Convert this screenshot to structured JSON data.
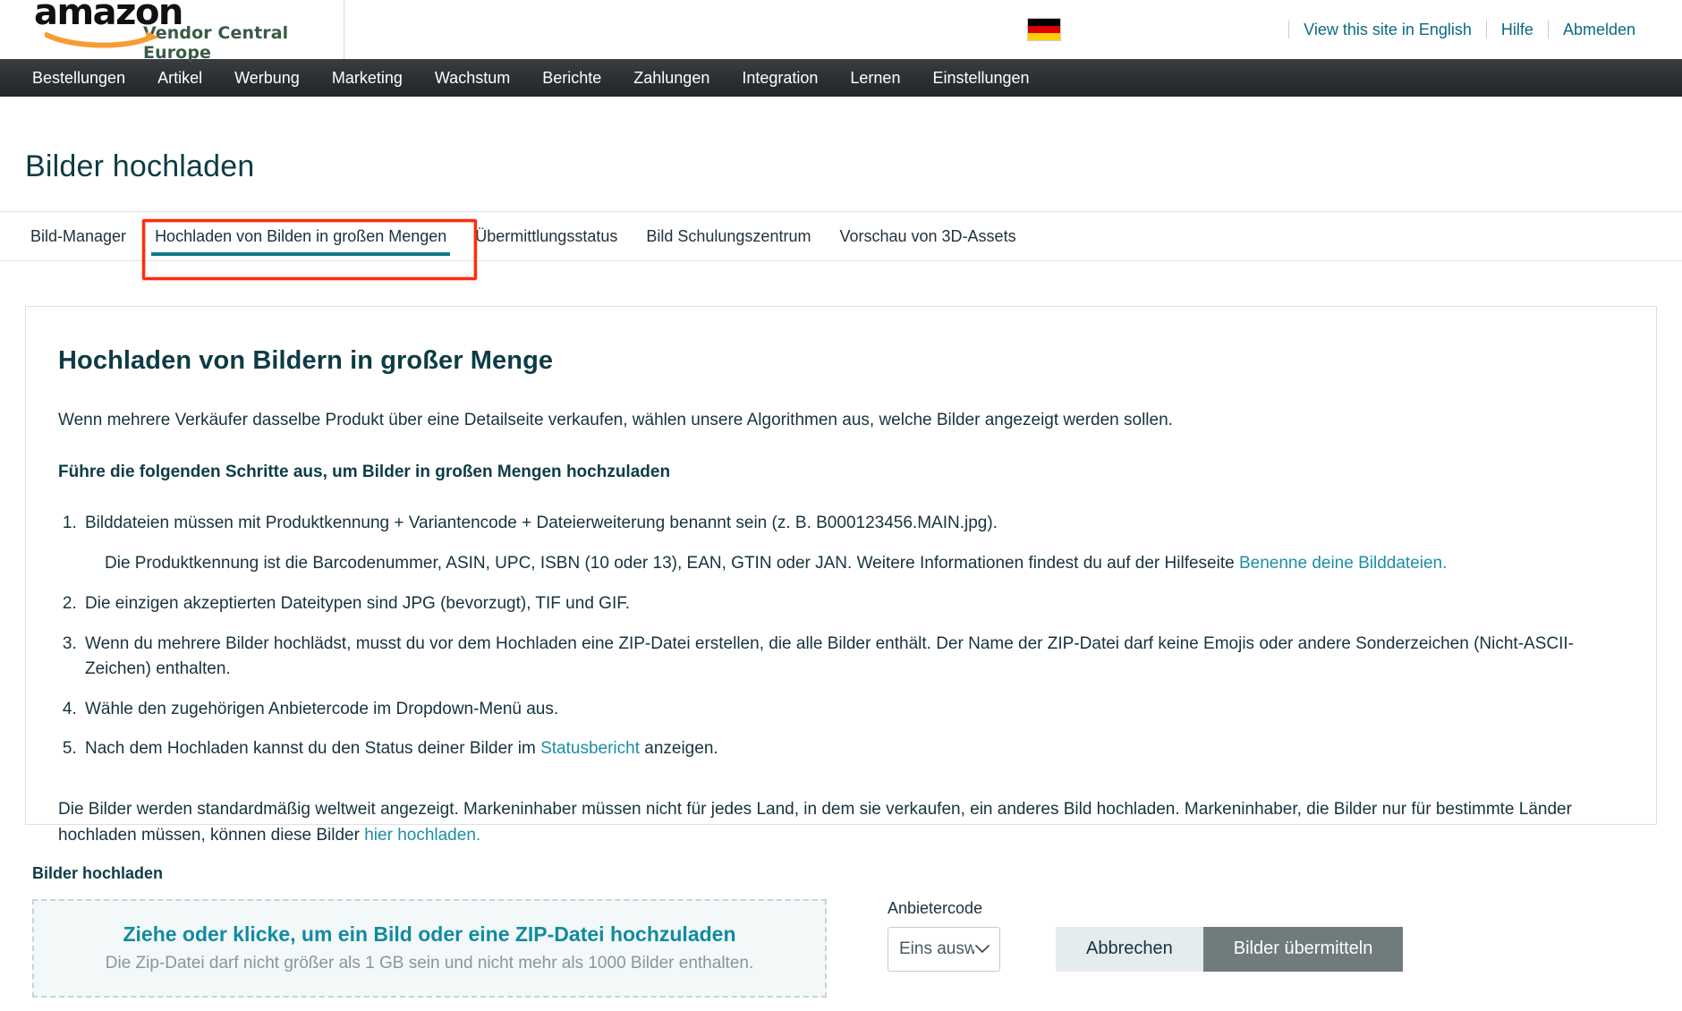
{
  "header": {
    "logo_main": "amazon",
    "logo_sub": "Vendor Central Europe",
    "flag": "german-flag",
    "links": [
      {
        "label": "View this site in English"
      },
      {
        "label": "Hilfe"
      },
      {
        "label": "Abmelden"
      }
    ]
  },
  "nav": {
    "items": [
      {
        "label": "Bestellungen"
      },
      {
        "label": "Artikel"
      },
      {
        "label": "Werbung"
      },
      {
        "label": "Marketing"
      },
      {
        "label": "Wachstum"
      },
      {
        "label": "Berichte"
      },
      {
        "label": "Zahlungen"
      },
      {
        "label": "Integration"
      },
      {
        "label": "Lernen"
      },
      {
        "label": "Einstellungen"
      }
    ]
  },
  "page": {
    "title": "Bilder hochladen"
  },
  "tabs": {
    "items": [
      {
        "label": "Bild-Manager",
        "active": false
      },
      {
        "label": "Hochladen von Bilden in großen Mengen",
        "active": true
      },
      {
        "label": "Übermittlungsstatus",
        "active": false
      },
      {
        "label": "Bild Schulungszentrum",
        "active": false
      },
      {
        "label": "Vorschau von 3D-Assets",
        "active": false
      }
    ],
    "annotation_color": "#fc2d10",
    "active_underline_color": "#127a8a"
  },
  "card": {
    "heading": "Hochladen von Bildern in großer Menge",
    "lead": "Wenn mehrere Verkäufer dasselbe Produkt über eine Detailseite verkaufen, wählen unsere Algorithmen aus, welche Bilder angezeigt werden sollen.",
    "steps_heading": "Führe die folgenden Schritte aus, um Bilder in großen Mengen hochzuladen",
    "step1": "Bilddateien müssen mit Produktkennung + Variantencode + Dateierweiterung benannt sein (z. B. B000123456.MAIN.jpg).",
    "step1_note_prefix": "Die Produktkennung ist die Barcodenummer, ASIN, UPC, ISBN (10 oder 13), EAN, GTIN oder JAN. Weitere Informationen findest du auf der Hilfeseite ",
    "step1_note_link": "Benenne deine Bilddateien.",
    "step2": "Die einzigen akzeptierten Dateitypen sind JPG (bevorzugt), TIF und GIF.",
    "step3": "Wenn du mehrere Bilder hochlädst, musst du vor dem Hochladen eine ZIP-Datei erstellen, die alle Bilder enthält. Der Name der ZIP-Datei darf keine Emojis oder andere Sonderzeichen (Nicht-ASCII-Zeichen) enthalten.",
    "step4": "Wähle den zugehörigen Anbietercode im Dropdown-Menü aus.",
    "step5_prefix": "Nach dem Hochladen kannst du den Status deiner Bilder im ",
    "step5_link": "Statusbericht",
    "step5_suffix": " anzeigen.",
    "closing_prefix": "Die Bilder werden standardmäßig weltweit angezeigt. Markeninhaber müssen nicht für jedes Land, in dem sie verkaufen, ein anderes Bild hochladen. Markeninhaber, die Bilder nur für bestimmte Länder hochladen müssen, können diese Bilder ",
    "closing_link": "hier hochladen."
  },
  "upload": {
    "section_label": "Bilder hochladen",
    "dropzone_title": "Ziehe oder klicke, um ein Bild oder eine ZIP-Datei hochzuladen",
    "dropzone_sub": "Die Zip-Datei darf nicht größer als 1 GB sein und nicht mehr als 1000 Bilder enthalten.",
    "vendor_code_label": "Anbietercode",
    "vendor_code_value": "Eins auswählen",
    "cancel_label": "Abbrechen",
    "submit_label": "Bilder übermitteln"
  },
  "colors": {
    "teal": "#127a8a",
    "link": "#1a8fa3",
    "heading": "#0d3c45",
    "nav_bg": "#2f3336",
    "annotation": "#fc2d10",
    "submit_bg": "#6f7b7d",
    "cancel_bg": "#e4ecee"
  }
}
